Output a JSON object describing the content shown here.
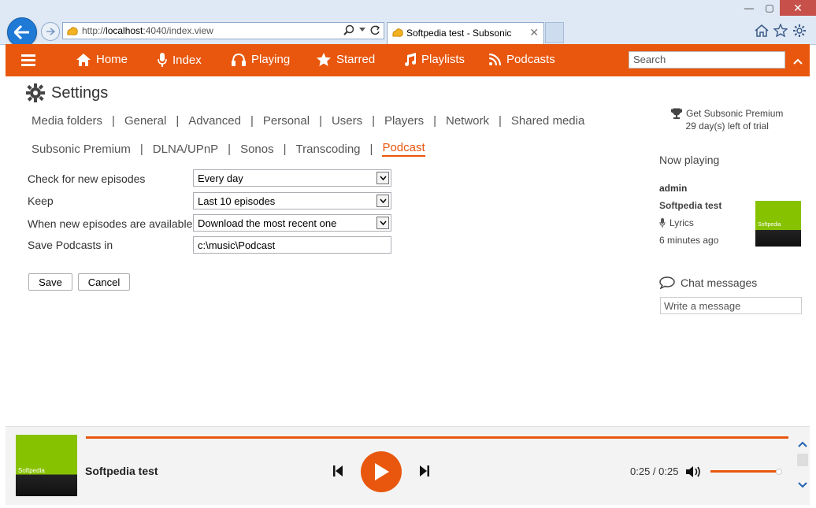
{
  "browser": {
    "url_prefix": "http://",
    "url_host": "localhost",
    "url_rest": ":4040/index.view",
    "tab_title": "Softpedia test - Subsonic",
    "tab_close": "✕"
  },
  "nav": {
    "home": "Home",
    "index": "Index",
    "playing": "Playing",
    "starred": "Starred",
    "playlists": "Playlists",
    "podcasts": "Podcasts",
    "search_placeholder": "Search"
  },
  "settings": {
    "title": "Settings",
    "tabs_row1": [
      "Media folders",
      "General",
      "Advanced",
      "Personal",
      "Users",
      "Players",
      "Network",
      "Shared media"
    ],
    "tabs_row2": [
      "Subsonic Premium",
      "DLNA/UPnP",
      "Sonos",
      "Transcoding",
      "Podcast"
    ],
    "active_tab": "Podcast"
  },
  "form": {
    "check_label": "Check for new episodes",
    "check_value": "Every day",
    "keep_label": "Keep",
    "keep_value": "Last 10 episodes",
    "new_label": "When new episodes are available",
    "new_value": "Download the most recent one",
    "save_in_label": "Save Podcasts in",
    "save_in_value": "c:\\music\\Podcast",
    "save_button": "Save",
    "cancel_button": "Cancel"
  },
  "sidebar": {
    "premium_line1": "Get Subsonic Premium",
    "premium_line2": "29 day(s) left of trial",
    "now_playing_title": "Now playing",
    "user": "admin",
    "track": "Softpedia test",
    "lyrics": "Lyrics",
    "ago": "6 minutes ago",
    "art_text": "Softpedia",
    "chat_title": "Chat messages",
    "chat_placeholder": "Write a message"
  },
  "player": {
    "title": "Softpedia test",
    "art_text": "Softpedia",
    "time": "0:25 / 0:25",
    "progress_fraction": 1.0,
    "volume_fraction": 0.95
  },
  "colors": {
    "accent": "#e8570d",
    "art_green": "#87c200"
  }
}
